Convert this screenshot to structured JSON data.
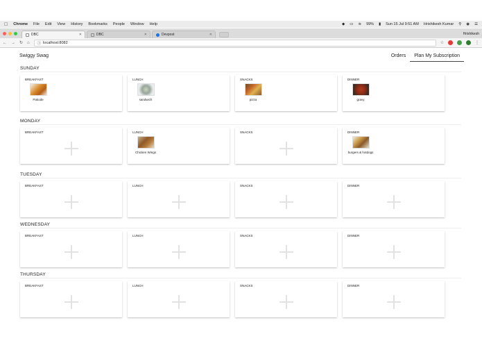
{
  "menubar": {
    "app": "Chrome",
    "items": [
      "File",
      "Edit",
      "View",
      "History",
      "Bookmarks",
      "People",
      "Window",
      "Help"
    ],
    "battery": "99%",
    "datetime": "Sun 15 Jul  9:51 AM",
    "user": "Hrishikesh Kumar"
  },
  "tabs": [
    {
      "title": "DBC",
      "active": true
    },
    {
      "title": "DBC",
      "active": false
    },
    {
      "title": "Devpost",
      "active": false
    }
  ],
  "profile_name": "Hrishikesh",
  "address_bar": {
    "url": "localhost:8082"
  },
  "header": {
    "brand": "Swiggy Swag",
    "nav": [
      {
        "label": "Orders",
        "active": false
      },
      {
        "label": "Plan My Subscription",
        "active": true
      }
    ]
  },
  "days": [
    {
      "name": "SUNDAY",
      "meals": [
        {
          "label": "BREAKFAST",
          "food": {
            "name": "Pakode",
            "img": "pakode"
          }
        },
        {
          "label": "LUNCH",
          "food": {
            "name": "sandwich",
            "img": "sandwich"
          }
        },
        {
          "label": "SNACKS",
          "food": {
            "name": "pizza",
            "img": "pizza"
          }
        },
        {
          "label": "DINNER",
          "food": {
            "name": "gravy",
            "img": "gravy"
          }
        }
      ]
    },
    {
      "name": "MONDAY",
      "meals": [
        {
          "label": "BREAKFAST",
          "food": null
        },
        {
          "label": "LUNCH",
          "food": {
            "name": "Chicken Wings",
            "img": "wings"
          }
        },
        {
          "label": "SNACKS",
          "food": null
        },
        {
          "label": "DINNER",
          "food": {
            "name": "burgers & hotdogs",
            "img": "burgers"
          }
        }
      ]
    },
    {
      "name": "TUESDAY",
      "meals": [
        {
          "label": "BREAKFAST",
          "food": null
        },
        {
          "label": "LUNCH",
          "food": null
        },
        {
          "label": "SNACKS",
          "food": null
        },
        {
          "label": "DINNER",
          "food": null
        }
      ]
    },
    {
      "name": "WEDNESDAY",
      "meals": [
        {
          "label": "BREAKFAST",
          "food": null
        },
        {
          "label": "LUNCH",
          "food": null
        },
        {
          "label": "SNACKS",
          "food": null
        },
        {
          "label": "DINNER",
          "food": null
        }
      ]
    },
    {
      "name": "THURSDAY",
      "meals": [
        {
          "label": "BREAKFAST",
          "food": null
        },
        {
          "label": "LUNCH",
          "food": null
        },
        {
          "label": "SNACKS",
          "food": null
        },
        {
          "label": "DINNER",
          "food": null
        }
      ]
    }
  ],
  "icons": {
    "add_meal": "plus-icon"
  }
}
